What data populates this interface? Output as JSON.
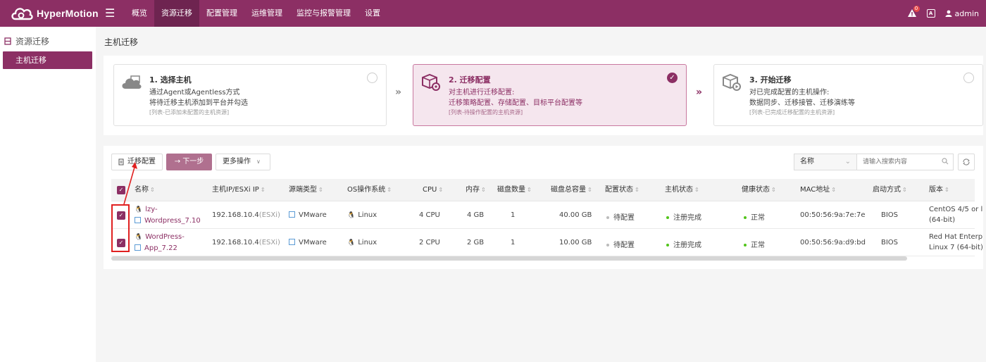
{
  "app": {
    "name": "HyperMotion"
  },
  "nav": {
    "menu_icon": "menu-icon",
    "items": [
      {
        "label": "概览",
        "active": false
      },
      {
        "label": "资源迁移",
        "active": true
      },
      {
        "label": "配置管理",
        "active": false
      },
      {
        "label": "运维管理",
        "active": false
      },
      {
        "label": "监控与报警管理",
        "active": false
      },
      {
        "label": "设置",
        "active": false
      }
    ]
  },
  "topright": {
    "alert_count": "0",
    "lang_icon": "A",
    "user": "admin"
  },
  "sidebar": {
    "group_label": "资源迁移",
    "items": [
      {
        "label": "主机迁移",
        "active": true
      }
    ]
  },
  "page": {
    "title": "主机迁移"
  },
  "steps": [
    {
      "title": "1. 选择主机",
      "lines": [
        "通过Agent或Agentless方式",
        "将待迁移主机添加到平台并勾选"
      ],
      "note": "[列表-已添加未配置的主机资源]",
      "checked": false
    },
    {
      "title": "2. 迁移配置",
      "lines": [
        "对主机进行迁移配置:",
        "迁移策略配置、存储配置、目标平台配置等"
      ],
      "note": "[列表-待操作配置的主机资源]",
      "checked": true
    },
    {
      "title": "3. 开始迁移",
      "lines": [
        "对已完成配置的主机操作:",
        "数据同步、迁移接管、迁移演练等"
      ],
      "note": "[列表-已完成迁移配置的主机资源]",
      "checked": false
    }
  ],
  "toolbar": {
    "config_label": "迁移配置",
    "next_label": "→ 下一步",
    "more_label": "更多操作",
    "search_field": "名称",
    "search_placeholder": "请输入搜索内容"
  },
  "table": {
    "columns": [
      "名称",
      "主机IP/ESXi IP",
      "源端类型",
      "OS操作系统",
      "CPU",
      "内存",
      "磁盘数量",
      "磁盘总容量",
      "配置状态",
      "主机状态",
      "健康状态",
      "MAC地址",
      "启动方式",
      "版本"
    ],
    "rows": [
      {
        "name_line1": "lzy-",
        "name_line2": "Wordpress_7.10",
        "ip": "192.168.10.4",
        "ip_suffix": "(ESXi)",
        "source": "VMware",
        "os": "Linux",
        "cpu": "4 CPU",
        "mem": "4 GB",
        "disks": "1",
        "disk_total": "40.00 GB",
        "config_status": "待配置",
        "host_status": "注册完成",
        "health": "正常",
        "mac": "00:50:56:9a:7e:7e",
        "boot": "BIOS",
        "version_line1": "CentOS 4/5 or l",
        "version_line2": "(64-bit)",
        "checked": true
      },
      {
        "name_line1": "WordPress-",
        "name_line2": "App_7.22",
        "ip": "192.168.10.4",
        "ip_suffix": "(ESXi)",
        "source": "VMware",
        "os": "Linux",
        "cpu": "2 CPU",
        "mem": "2 GB",
        "disks": "1",
        "disk_total": "10.00 GB",
        "config_status": "待配置",
        "host_status": "注册完成",
        "health": "正常",
        "mac": "00:50:56:9a:d9:bd",
        "boot": "BIOS",
        "version_line1": "Red Hat Enterp",
        "version_line2": "Linux 7 (64-bit)",
        "checked": true
      }
    ]
  },
  "colors": {
    "brand": "#8c2f64",
    "ok": "#52c41a",
    "pending": "#bbbbbb"
  }
}
